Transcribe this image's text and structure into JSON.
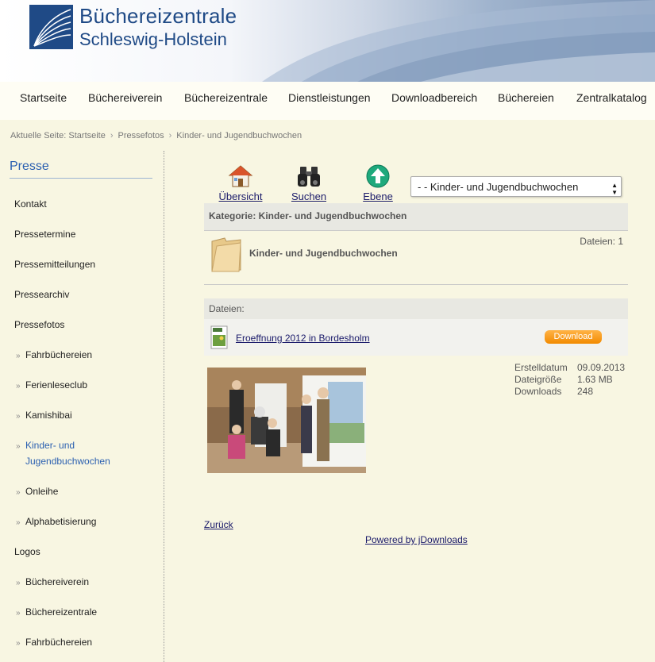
{
  "header": {
    "title_line1": "Büchereizentrale",
    "title_line2": "Schleswig-Holstein",
    "brand_color": "#1f4a86"
  },
  "nav": {
    "items": [
      "Startseite",
      "Büchereiverein",
      "Büchereizentrale",
      "Dienstleistungen",
      "Downloadbereich",
      "Büchereien",
      "Zentralkatalog"
    ]
  },
  "breadcrumb": {
    "prefix": "Aktuelle Seite:",
    "items": [
      "Startseite",
      "Pressefotos",
      "Kinder- und Jugendbuchwochen"
    ]
  },
  "sidebar": {
    "title": "Presse",
    "items": [
      {
        "label": "Kontakt"
      },
      {
        "label": "Pressetermine"
      },
      {
        "label": "Pressemitteilungen"
      },
      {
        "label": "Pressearchiv"
      },
      {
        "label": "Pressefotos"
      },
      {
        "label": "Fahrbüchereien"
      },
      {
        "label": "Ferienleseclub"
      },
      {
        "label": "Kamishibai"
      },
      {
        "label": "Kinder- und"
      },
      {
        "label": "Jugendbuchwochen"
      },
      {
        "label": "Onleihe"
      },
      {
        "label": "Alphabetisierung"
      },
      {
        "label": "Logos"
      },
      {
        "label": "Büchereiverein"
      },
      {
        "label": "Büchereizentrale"
      },
      {
        "label": "Fahrbüchereien"
      }
    ]
  },
  "toolbar": {
    "overview": "Übersicht",
    "search": "Suchen",
    "level": "Ebene",
    "select_value": "- - Kinder- und Jugendbuchwochen"
  },
  "category": {
    "bar_label": "Kategorie: Kinder- und Jugendbuchwochen",
    "files_count": "Dateien: 1",
    "name": "Kinder- und Jugendbuchwochen"
  },
  "files": {
    "bar_label": "Dateien:",
    "file_name": "Eroeffnung 2012 in Bordesholm",
    "download_label": "Download",
    "meta": [
      {
        "key": "Erstelldatum",
        "value": "09.09.2013"
      },
      {
        "key": "Dateigröße",
        "value": "1.63 MB"
      },
      {
        "key": "Downloads",
        "value": "248"
      }
    ]
  },
  "footer": {
    "back": "Zurück",
    "powered": "Powered by jDownloads"
  }
}
